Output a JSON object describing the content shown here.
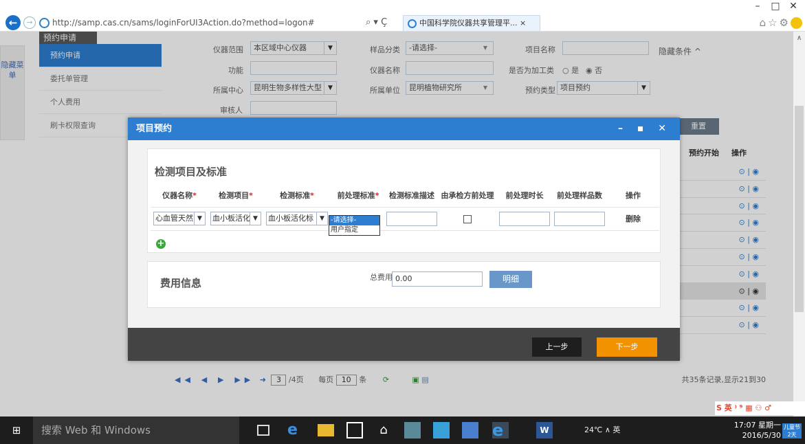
{
  "browser": {
    "url": "http://samp.cas.cn/sams/loginForUI3Action.do?method=logon#",
    "url_host": "samp.cas.cn",
    "search_ctrl": "⌕ ▾ Ç",
    "tab_title": "中国科学院仪器共享管理平...",
    "win_min": "–",
    "win_max": "□",
    "win_close": "✕"
  },
  "page": {
    "hidden_menu": "隐藏菜单",
    "sidebar": {
      "title": "预约申请",
      "items": [
        "预约申请",
        "委托单管理",
        "个人费用",
        "刷卡权限查询"
      ]
    },
    "filters": {
      "instrument_range_label": "仪器范围",
      "instrument_range_value": "本区域中心仪器",
      "sample_type_label": "样品分类",
      "sample_type_value": "-请选择-",
      "project_name_label": "项目名称",
      "hide_condition": "隐藏条件 ^",
      "function_label": "功能",
      "instrument_name_label": "仪器名称",
      "processing_label": "是否为加工类",
      "processing_yes": "○ 是",
      "processing_no": "◉ 否",
      "center_label": "所属中心",
      "center_value": "昆明生物多样性大型",
      "unit_label": "所属单位",
      "unit_value": "昆明植物研究所",
      "type_label": "预约类型",
      "type_value": "项目预约",
      "reviewer_label": "审核人",
      "reset": "重置"
    },
    "table": {
      "col_start": "预约开始",
      "col_op": "操作",
      "row_icon": "⊙ | ◉",
      "rows": 10,
      "selected_row": 8
    },
    "pager": {
      "nav": "◀◀ ◀ ▶ ▶▶",
      "goto": "➜",
      "page": "3",
      "pages": "/4页",
      "per_page_label": "每页",
      "per_page": "10",
      "per_page_unit": "条",
      "total": "共35条记录,显示21到30"
    }
  },
  "dialog": {
    "title": "项目预约",
    "controls": "– ▪ ✕",
    "section1_title": "检测项目及标准",
    "columns": [
      {
        "label": "仪器名称",
        "required": true
      },
      {
        "label": "检测项目",
        "required": true
      },
      {
        "label": "检测标准",
        "required": true
      },
      {
        "label": "前处理标准",
        "required": true
      },
      {
        "label": "检测标准描述",
        "required": false
      },
      {
        "label": "由承检方前处理",
        "required": false
      },
      {
        "label": "前处理时长",
        "required": false
      },
      {
        "label": "前处理样品数",
        "required": false
      },
      {
        "label": "操作",
        "required": false
      }
    ],
    "row": {
      "instrument": "心血管天然",
      "item": "血小板活化",
      "standard": "血小板活化标",
      "delete": "删除"
    },
    "pretreat_options": [
      "-请选择-",
      "用户指定"
    ],
    "add_icon": "+",
    "section2_title": "费用信息",
    "total_fee_label": "总费用",
    "total_fee_value": "0.00",
    "detail_button": "明细",
    "prev_button": "上一步",
    "next_button": "下一步"
  },
  "taskbar": {
    "start": "⊞",
    "search_placeholder": "搜索 Web 和 Windows",
    "tray_text": "24℃ ∧ 英",
    "time": "17:07 星期一",
    "date": "2016/5/30",
    "notify": "儿童节 2天",
    "ime": "S 英 ⁾ ⁹ ▦ ⚇ ♂"
  }
}
